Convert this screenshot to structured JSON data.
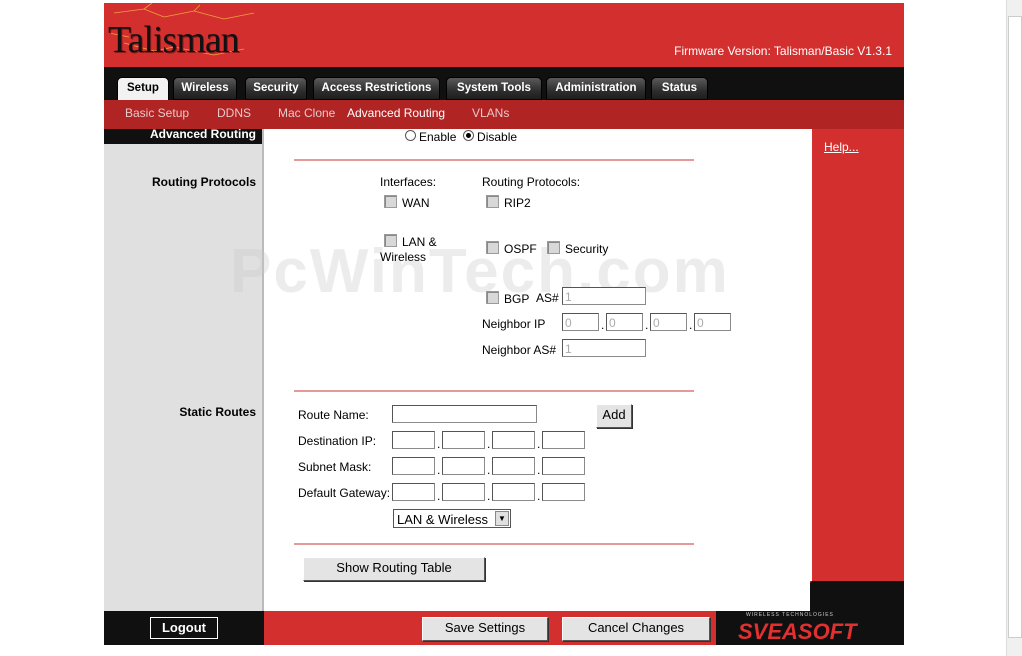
{
  "header": {
    "brand": "Talisman",
    "firmware": "Firmware Version: Talisman/Basic V1.3.1"
  },
  "tabs": [
    "Setup",
    "Wireless",
    "Security",
    "Access Restrictions",
    "System Tools",
    "Administration",
    "Status"
  ],
  "subnav": [
    "Basic Setup",
    "DDNS",
    "Mac Clone",
    "Advanced Routing",
    "VLANs"
  ],
  "section_titles": {
    "advanced_routing": "Advanced Routing",
    "routing_protocols": "Routing Protocols",
    "static_routes": "Static Routes"
  },
  "help_label": "Help...",
  "routing": {
    "enable_label": "Enable",
    "disable_label": "Disable",
    "selected": "Disable",
    "interfaces_header": "Interfaces:",
    "protocols_header": "Routing Protocols:",
    "wan_label": "WAN",
    "lan_label": "LAN &",
    "lan_label2": "Wireless",
    "rip2_label": "RIP2",
    "ospf_label": "OSPF",
    "security_label": "Security",
    "bgp_label": "BGP",
    "as_label": "AS#",
    "as_value": "1",
    "neighbor_ip_label": "Neighbor IP",
    "neighbor_ip": [
      "0",
      "0",
      "0",
      "0"
    ],
    "neighbor_as_label": "Neighbor AS#",
    "neighbor_as_value": "1"
  },
  "static": {
    "route_name_label": "Route Name:",
    "route_name_value": "",
    "add_label": "Add",
    "dest_ip_label": "Destination IP:",
    "subnet_label": "Subnet Mask:",
    "gateway_label": "Default Gateway:",
    "interface_select": "LAN & Wireless",
    "show_table_label": "Show Routing Table"
  },
  "footer": {
    "logout": "Logout",
    "save": "Save Settings",
    "cancel": "Cancel Changes",
    "vendor": "SVEASOFT",
    "vendor_tag": "WIRELESS TECHNOLOGIES"
  },
  "watermark": "PcWinTech.com"
}
